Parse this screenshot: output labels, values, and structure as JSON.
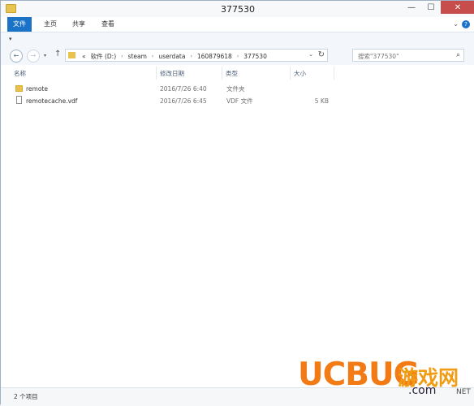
{
  "window": {
    "title": "377530",
    "controls": {
      "minimize": "—",
      "maximize": "☐",
      "close": "✕"
    }
  },
  "ribbon": {
    "tabs": [
      "文件",
      "主页",
      "共享",
      "查看"
    ],
    "active_tab": "文件",
    "help_icon": "?",
    "expand_icon": "⌄"
  },
  "quick_access": {
    "dropdown_icon": "▾"
  },
  "navigation": {
    "back_icon": "←",
    "forward_icon": "→",
    "history_icon": "▾",
    "up_icon": "↑",
    "breadcrumb_prefix": "«",
    "breadcrumb": [
      "软件 (D:)",
      "steam",
      "userdata",
      "160879618",
      "377530"
    ],
    "separator": "›",
    "address_dropdown": "⌄",
    "refresh_icon": "↻",
    "search_placeholder": "搜索\"377530\"",
    "search_icon": "⌕"
  },
  "file_list": {
    "columns": {
      "name": "名称",
      "modified": "修改日期",
      "type": "类型",
      "size": "大小"
    },
    "rows": [
      {
        "icon": "folder-icon",
        "name": "remote",
        "modified": "2016/7/26 6:40",
        "type": "文件夹",
        "size": ""
      },
      {
        "icon": "file-icon",
        "name": "remotecache.vdf",
        "modified": "2016/7/26 6:45",
        "type": "VDF 文件",
        "size": "5 KB"
      }
    ]
  },
  "status": {
    "item_count": "2 个项目"
  },
  "watermark": {
    "brand": "UCBUG",
    "chinese": "游戏网",
    "domain": ".com",
    "tail": "NET"
  },
  "colors": {
    "accent": "#1a73c7",
    "close_button": "#c74c4c",
    "folder": "#e8c24d",
    "watermark_orange": "#f27b16"
  }
}
